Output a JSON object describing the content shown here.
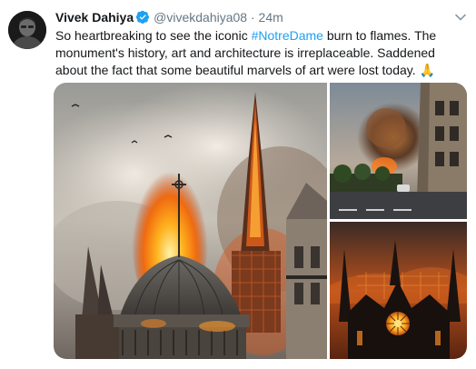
{
  "tweet": {
    "author_name": "Vivek Dahiya",
    "handle": "@vivekdahiya08",
    "separator": "·",
    "time": "24m",
    "text_before": "So heartbreaking to see the iconic ",
    "hashtag": "#NotreDame",
    "text_after": " burn to flames. The monument's history, art and architecture is irreplaceable. Saddened about the fact that some beautiful marvels of art were lost today. ",
    "emoji": "🙏"
  },
  "icons": {
    "verified": "verified-badge-icon",
    "menu": "chevron-down-icon"
  },
  "media": {
    "count": 3,
    "images": [
      "notre-dame-spire-fire",
      "notre-dame-smoke-street-view",
      "notre-dame-rose-window-fire"
    ]
  },
  "colors": {
    "text": "#14171a",
    "secondary": "#657786",
    "accent": "#1da1f2"
  }
}
